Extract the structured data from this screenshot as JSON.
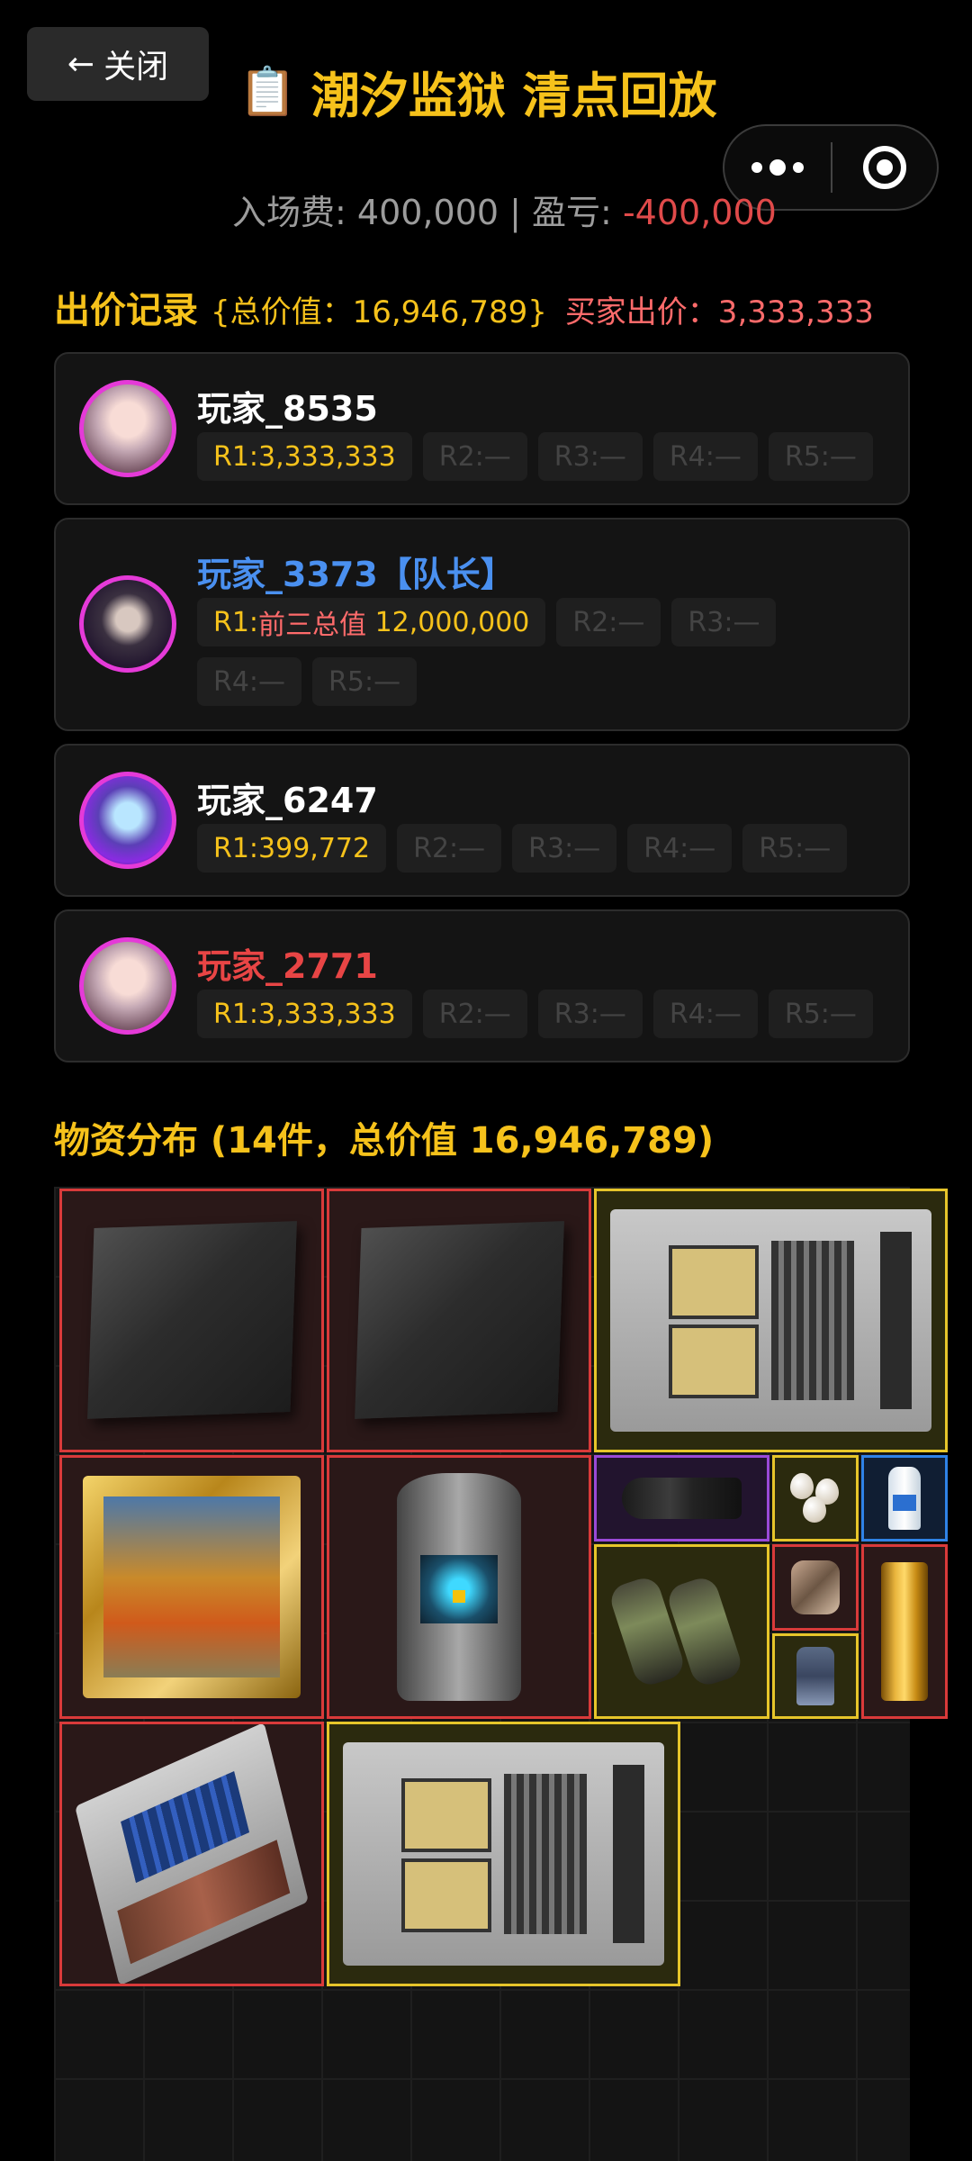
{
  "header": {
    "close_label": "关闭",
    "close_arrow": "←",
    "title_icon": "📋",
    "title": "潮汐监狱 清点回放",
    "fee_label": "入场费:",
    "fee_value": "400,000",
    "pnl_label": "盈亏:",
    "pnl_value": "-400,000"
  },
  "bids": {
    "section_title": "出价记录",
    "total_text": "{总价值：16,946,789}",
    "buyer_text": "买家出价：3,333,333",
    "players": [
      {
        "name": "玩家_8535",
        "name_color": "#ffffff",
        "avatar": "avatar-girl-icon",
        "rounds": [
          {
            "text": "R1:3,333,333",
            "prefix": "",
            "filled": true
          },
          {
            "text": "R2:—",
            "filled": false
          },
          {
            "text": "R3:—",
            "filled": false
          },
          {
            "text": "R4:—",
            "filled": false
          },
          {
            "text": "R5:—",
            "filled": false
          }
        ]
      },
      {
        "name": "玩家_3373【队长】",
        "name_color": "#4a90f0",
        "avatar": "avatar-boy-icon",
        "rounds": [
          {
            "text": "12,000,000",
            "prefix_r1": "R1:",
            "prefix_red": "前三总值",
            "filled": true
          },
          {
            "text": "R2:—",
            "filled": false
          },
          {
            "text": "R3:—",
            "filled": false
          },
          {
            "text": "R4:—",
            "filled": false
          },
          {
            "text": "R5:—",
            "filled": false
          }
        ]
      },
      {
        "name": "玩家_6247",
        "name_color": "#ffffff",
        "avatar": "avatar-neon-icon",
        "rounds": [
          {
            "text": "R1:399,772",
            "filled": true
          },
          {
            "text": "R2:—",
            "filled": false
          },
          {
            "text": "R3:—",
            "filled": false
          },
          {
            "text": "R4:—",
            "filled": false
          },
          {
            "text": "R5:—",
            "filled": false
          }
        ]
      },
      {
        "name": "玩家_2771",
        "name_color": "#e84545",
        "avatar": "avatar-girl-icon",
        "rounds": [
          {
            "text": "R1:3,333,333",
            "filled": true
          },
          {
            "text": "R2:—",
            "filled": false
          },
          {
            "text": "R3:—",
            "filled": false
          },
          {
            "text": "R4:—",
            "filled": false
          },
          {
            "text": "R5:—",
            "filled": false
          }
        ]
      }
    ]
  },
  "loot": {
    "section_title": "物资分布 (14件，总价值 16,946,789)",
    "items": [
      {
        "name": "carbon-plate",
        "rarity": "red"
      },
      {
        "name": "carbon-plate",
        "rarity": "red"
      },
      {
        "name": "server-rack",
        "rarity": "gold"
      },
      {
        "name": "oil-painting",
        "rarity": "red"
      },
      {
        "name": "reactor-core",
        "rarity": "red"
      },
      {
        "name": "camera-lens",
        "rarity": "purple"
      },
      {
        "name": "pearls",
        "rarity": "gold"
      },
      {
        "name": "medicine-bottle",
        "rarity": "blue"
      },
      {
        "name": "binoculars",
        "rarity": "gold"
      },
      {
        "name": "gadget",
        "rarity": "red"
      },
      {
        "name": "gold-bar",
        "rarity": "red"
      },
      {
        "name": "small-part",
        "rarity": "gold"
      },
      {
        "name": "server-board",
        "rarity": "red"
      },
      {
        "name": "server-rack",
        "rarity": "gold"
      }
    ]
  },
  "capsule": {
    "menu_icon": "more-dots-icon",
    "close_icon": "target-circle-icon"
  }
}
